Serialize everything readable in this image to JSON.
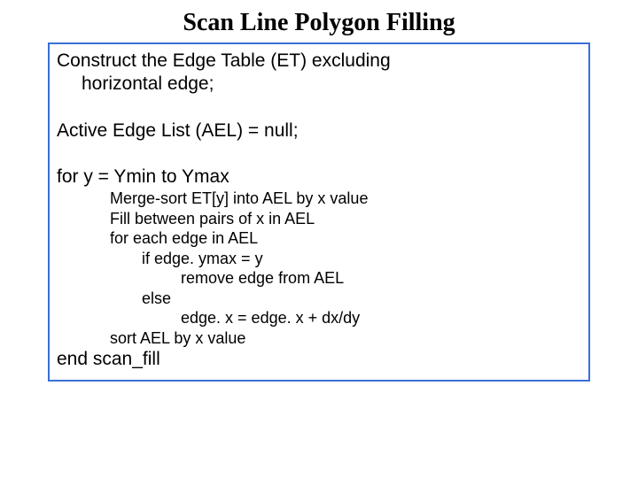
{
  "title": "Scan Line Polygon Filling",
  "lines": {
    "l1": "Construct the Edge Table (ET) excluding",
    "l1b": "horizontal edge;",
    "l2": "Active Edge List (AEL) = null;",
    "l3": "for y = Ymin to Ymax",
    "l4": "Merge-sort ET[y] into AEL by x value",
    "l5": "Fill between pairs of x in AEL",
    "l6": "for each edge in AEL",
    "l7": "if edge. ymax = y",
    "l8": "remove edge from AEL",
    "l9": "else",
    "l10": "edge. x = edge. x + dx/dy",
    "l11": "sort AEL by x value",
    "l12": "end scan_fill"
  }
}
